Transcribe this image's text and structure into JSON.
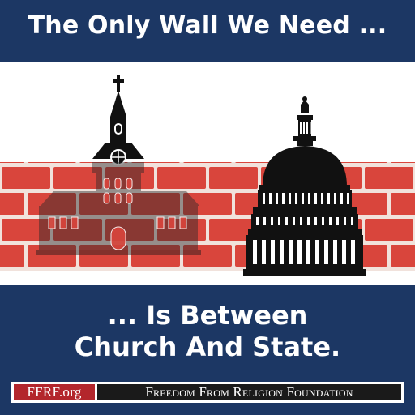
{
  "headline": "The Only Wall We Need ...",
  "subline": {
    "line1": "... Is Between",
    "line2": "Church And State."
  },
  "footer": {
    "site": "FFRF.org",
    "organization": "Freedom From Religion Foundation"
  },
  "colors": {
    "navy": "#1c3764",
    "brick": "#d9453c",
    "mortar": "#f1e2dc",
    "ffrf_red": "#b3262c",
    "silhouette": "#111111"
  },
  "icons": [
    "church-icon",
    "capitol-dome-icon",
    "brick-wall"
  ]
}
